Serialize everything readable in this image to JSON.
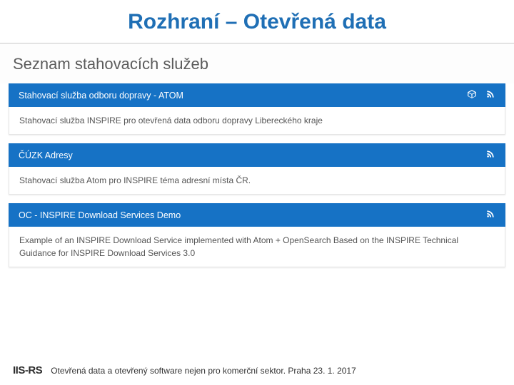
{
  "slide": {
    "title": "Rozhraní – Otevřená data",
    "section_heading": "Seznam stahovacích služeb"
  },
  "panels": [
    {
      "title": "Stahovací služba odboru dopravy - ATOM",
      "body": "Stahovací služba INSPIRE pro otevřená data odboru dopravy Libereckého kraje",
      "icons": [
        "cube",
        "rss"
      ]
    },
    {
      "title": "ČÚZK Adresy",
      "body": "Stahovací služba Atom pro INSPIRE téma adresní místa ČR.",
      "icons": [
        "rss"
      ]
    },
    {
      "title": "OC - INSPIRE Download Services Demo",
      "body": "Example of an INSPIRE Download Service implemented with Atom + OpenSearch Based on the INSPIRE Technical Guidance for INSPIRE Download Services 3.0",
      "icons": [
        "rss"
      ]
    }
  ],
  "footer": {
    "logo": "IIS-RS",
    "text": "Otevřená data a otevřený software nejen pro komerční sektor. Praha 23. 1. 2017"
  }
}
